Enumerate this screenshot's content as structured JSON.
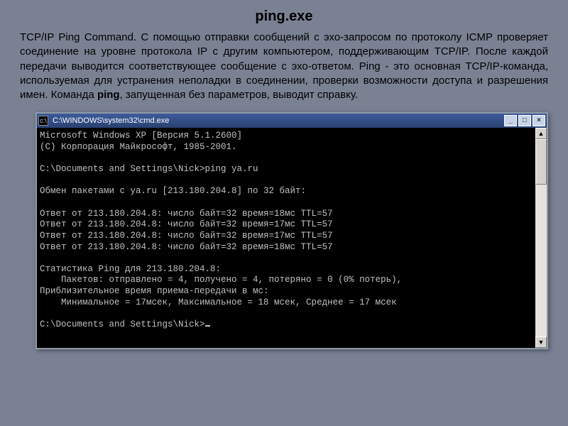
{
  "title": "ping.exe",
  "description_parts": {
    "p1": "TCP/IP Ping Command. С помощью отправки сообщений с эхо-запросом по протоколу ICMP проверяет соединение на уровне протокола IP с другим компьютером, поддерживающим TCP/IP. После каждой передачи выводится соответствующее сообщение с эхо-ответом. Ping - это основная TCP/IP-команда, используемая для устранения неполадки в соединении, проверки возможности доступа и разрешения имен. Команда ",
    "bold": "ping",
    "p2": ", запущенная без параметров, выводит справку."
  },
  "cmd": {
    "titlebar": "C:\\WINDOWS\\system32\\cmd.exe",
    "icon_glyph": "c:\\",
    "btn_min": "_",
    "btn_max": "□",
    "btn_close": "×",
    "sb_up": "▲",
    "sb_down": "▼",
    "lines": [
      "Microsoft Windows XP [Версия 5.1.2600]",
      "(C) Корпорация Майкрософт, 1985-2001.",
      "",
      "C:\\Documents and Settings\\Nick>ping ya.ru",
      "",
      "Обмен пакетами с ya.ru [213.180.204.8] по 32 байт:",
      "",
      "Ответ от 213.180.204.8: число байт=32 время=18мс TTL=57",
      "Ответ от 213.180.204.8: число байт=32 время=17мс TTL=57",
      "Ответ от 213.180.204.8: число байт=32 время=17мс TTL=57",
      "Ответ от 213.180.204.8: число байт=32 время=18мс TTL=57",
      "",
      "Статистика Ping для 213.180.204.8:",
      "    Пакетов: отправлено = 4, получено = 4, потеряно = 0 (0% потерь),",
      "Приблизительное время приема-передачи в мс:",
      "    Минимальное = 17мсек, Максимальное = 18 мсек, Среднее = 17 мсек",
      "",
      "C:\\Documents and Settings\\Nick>"
    ]
  }
}
